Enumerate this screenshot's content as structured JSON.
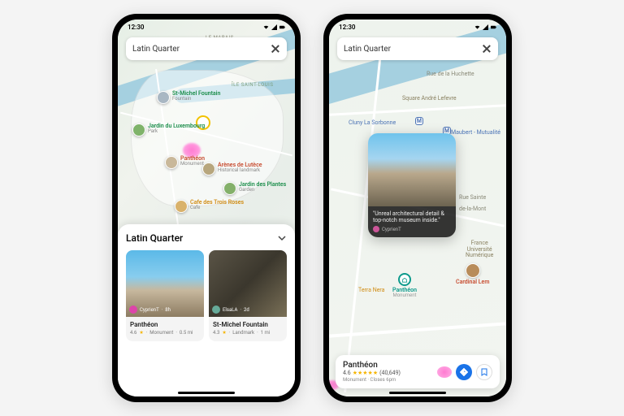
{
  "statusbar": {
    "time": "12:30"
  },
  "search": {
    "query": "Latin Quarter"
  },
  "phone1": {
    "pois": {
      "fountain": {
        "title": "St-Michel Fountain",
        "sub": "Fountain"
      },
      "lux": {
        "title": "Jardin du Luxembourg",
        "sub": "Park"
      },
      "pantheon": {
        "title": "Panthéon",
        "sub": "Monument"
      },
      "arenes": {
        "title": "Arènes de Lutèce",
        "sub": "Historical landmark"
      },
      "plantes": {
        "title": "Jardin des Plantes",
        "sub": "Garden"
      },
      "cafe": {
        "title": "Cafe des Trois Roses",
        "sub": "Cafe"
      }
    },
    "sheet": {
      "title": "Latin Quarter",
      "cards": [
        {
          "attr_user": "CyprienT",
          "attr_time": "8h",
          "name": "Panthéon",
          "rating": "4.6",
          "tag": "Monument",
          "dist": "0.5 mi"
        },
        {
          "attr_user": "ElsaLA",
          "attr_time": "2d",
          "name": "St-Michel Fountain",
          "rating": "4.3",
          "tag": "Landmark",
          "dist": "1 mi"
        }
      ]
    },
    "labels": {
      "marais": "LE MARAIS",
      "ile": "ÎLE SAINT-LOUIS"
    }
  },
  "phone2": {
    "labels": {
      "rue": "Rue de la Huchette",
      "square": "Square André Lefevre",
      "cluny": "Cluny La Sorbonne",
      "maubert": "Maubert - Mutualité",
      "sainte": "Rue Sainte",
      "mont": "de-la-Mont",
      "univ1": "France",
      "univ2": "Université",
      "univ3": "Numérique",
      "terra": "Terra Nera"
    },
    "pois": {
      "pantheon": {
        "title": "Panthéon",
        "sub": "Monument"
      },
      "cardinal": {
        "title": "Cardinal Lem"
      }
    },
    "preview": {
      "quote": "\"Unreal architectural detail & top-notch museum inside.\"",
      "author": "CyprienT"
    },
    "bottom": {
      "name": "Panthéon",
      "rating": "4.6",
      "reviews": "(40,649)",
      "sub": "Monument · Closes 6pm"
    }
  }
}
